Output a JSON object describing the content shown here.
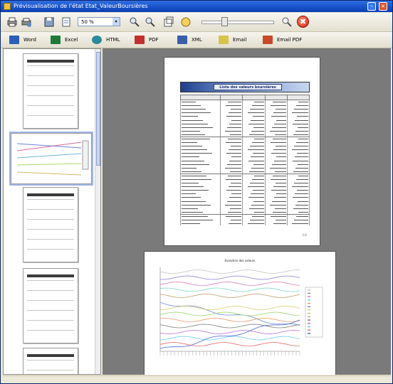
{
  "window": {
    "title": "Prévisualisation de l'état Etat_ValeurBoursières"
  },
  "toolbar": {
    "zoom_value": "50 %",
    "zoom_arrow": "▾",
    "stop_glyph": "✖"
  },
  "export_buttons": [
    {
      "label": "Word",
      "color": "#2b5fb8"
    },
    {
      "label": "Excel",
      "color": "#1f7a3a"
    },
    {
      "label": "HTML",
      "color": "#2a8a9a"
    },
    {
      "label": "PDF",
      "color": "#c23030"
    },
    {
      "label": "XML",
      "color": "#3a5fa8"
    },
    {
      "label": "Email",
      "color": "#d8c24a"
    },
    {
      "label": "Email PDF",
      "color": "#c84a2a"
    }
  ],
  "page1": {
    "banner_title": "Liste des valeurs boursières",
    "page_number": "1/2"
  },
  "chart_data": {
    "type": "line",
    "title": "Evolution des valeurs"
  }
}
